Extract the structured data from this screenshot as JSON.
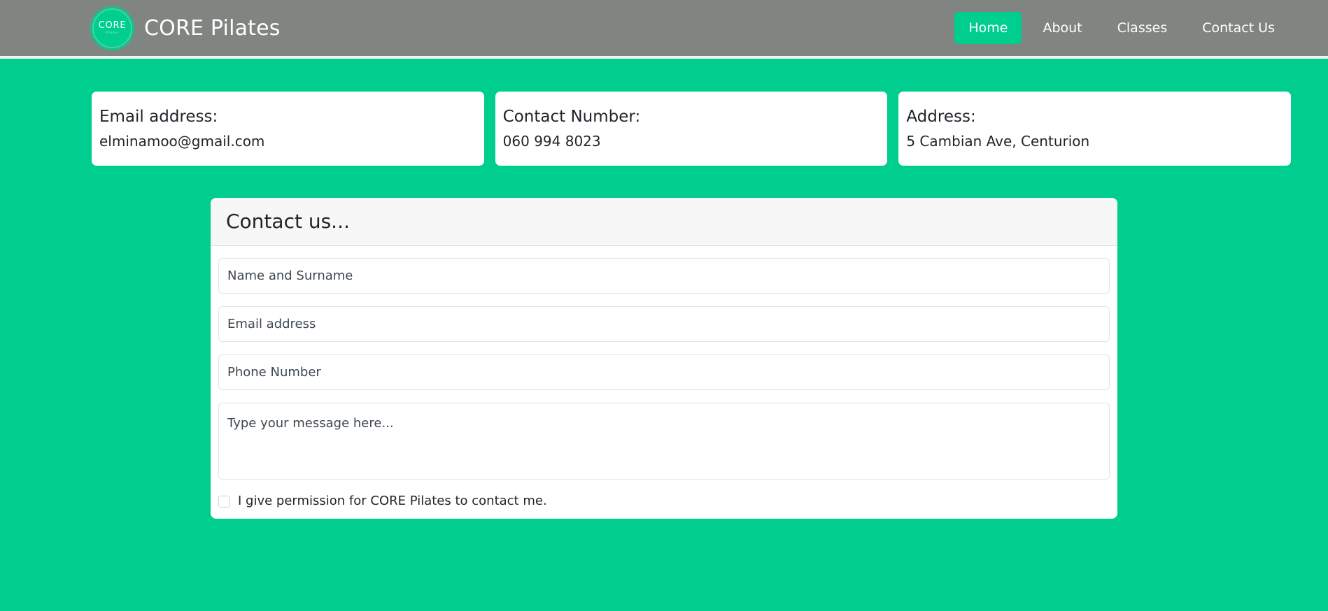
{
  "theme": {
    "brand_green": "#00ce8e",
    "navbar_gray": "#808581",
    "card_header_gray": "#f7f7f7",
    "text_dark": "#20252a"
  },
  "navbar": {
    "logo": {
      "icon": "core-circle-logo",
      "main_text": "CORE",
      "sub_text": "Pilates"
    },
    "brand_name": "CORE Pilates",
    "links": [
      {
        "label": "Home",
        "active": true
      },
      {
        "label": "About",
        "active": false
      },
      {
        "label": "Classes",
        "active": false
      },
      {
        "label": "Contact Us",
        "active": false
      }
    ]
  },
  "info_cards": [
    {
      "title": "Email address:",
      "value": "elminamoo@gmail.com"
    },
    {
      "title": "Contact Number:",
      "value": "060 994 8023"
    },
    {
      "title": "Address:",
      "value": "5 Cambian Ave, Centurion"
    }
  ],
  "contact_form": {
    "title": "Contact us...",
    "fields": {
      "name": {
        "placeholder": "Name and Surname",
        "value": ""
      },
      "email": {
        "placeholder": "Email address",
        "value": ""
      },
      "phone": {
        "placeholder": "Phone Number",
        "value": ""
      },
      "message": {
        "placeholder": "Type your message here...",
        "value": ""
      }
    },
    "consent": {
      "label": "I give permission for CORE Pilates to contact me.",
      "checked": false
    }
  }
}
